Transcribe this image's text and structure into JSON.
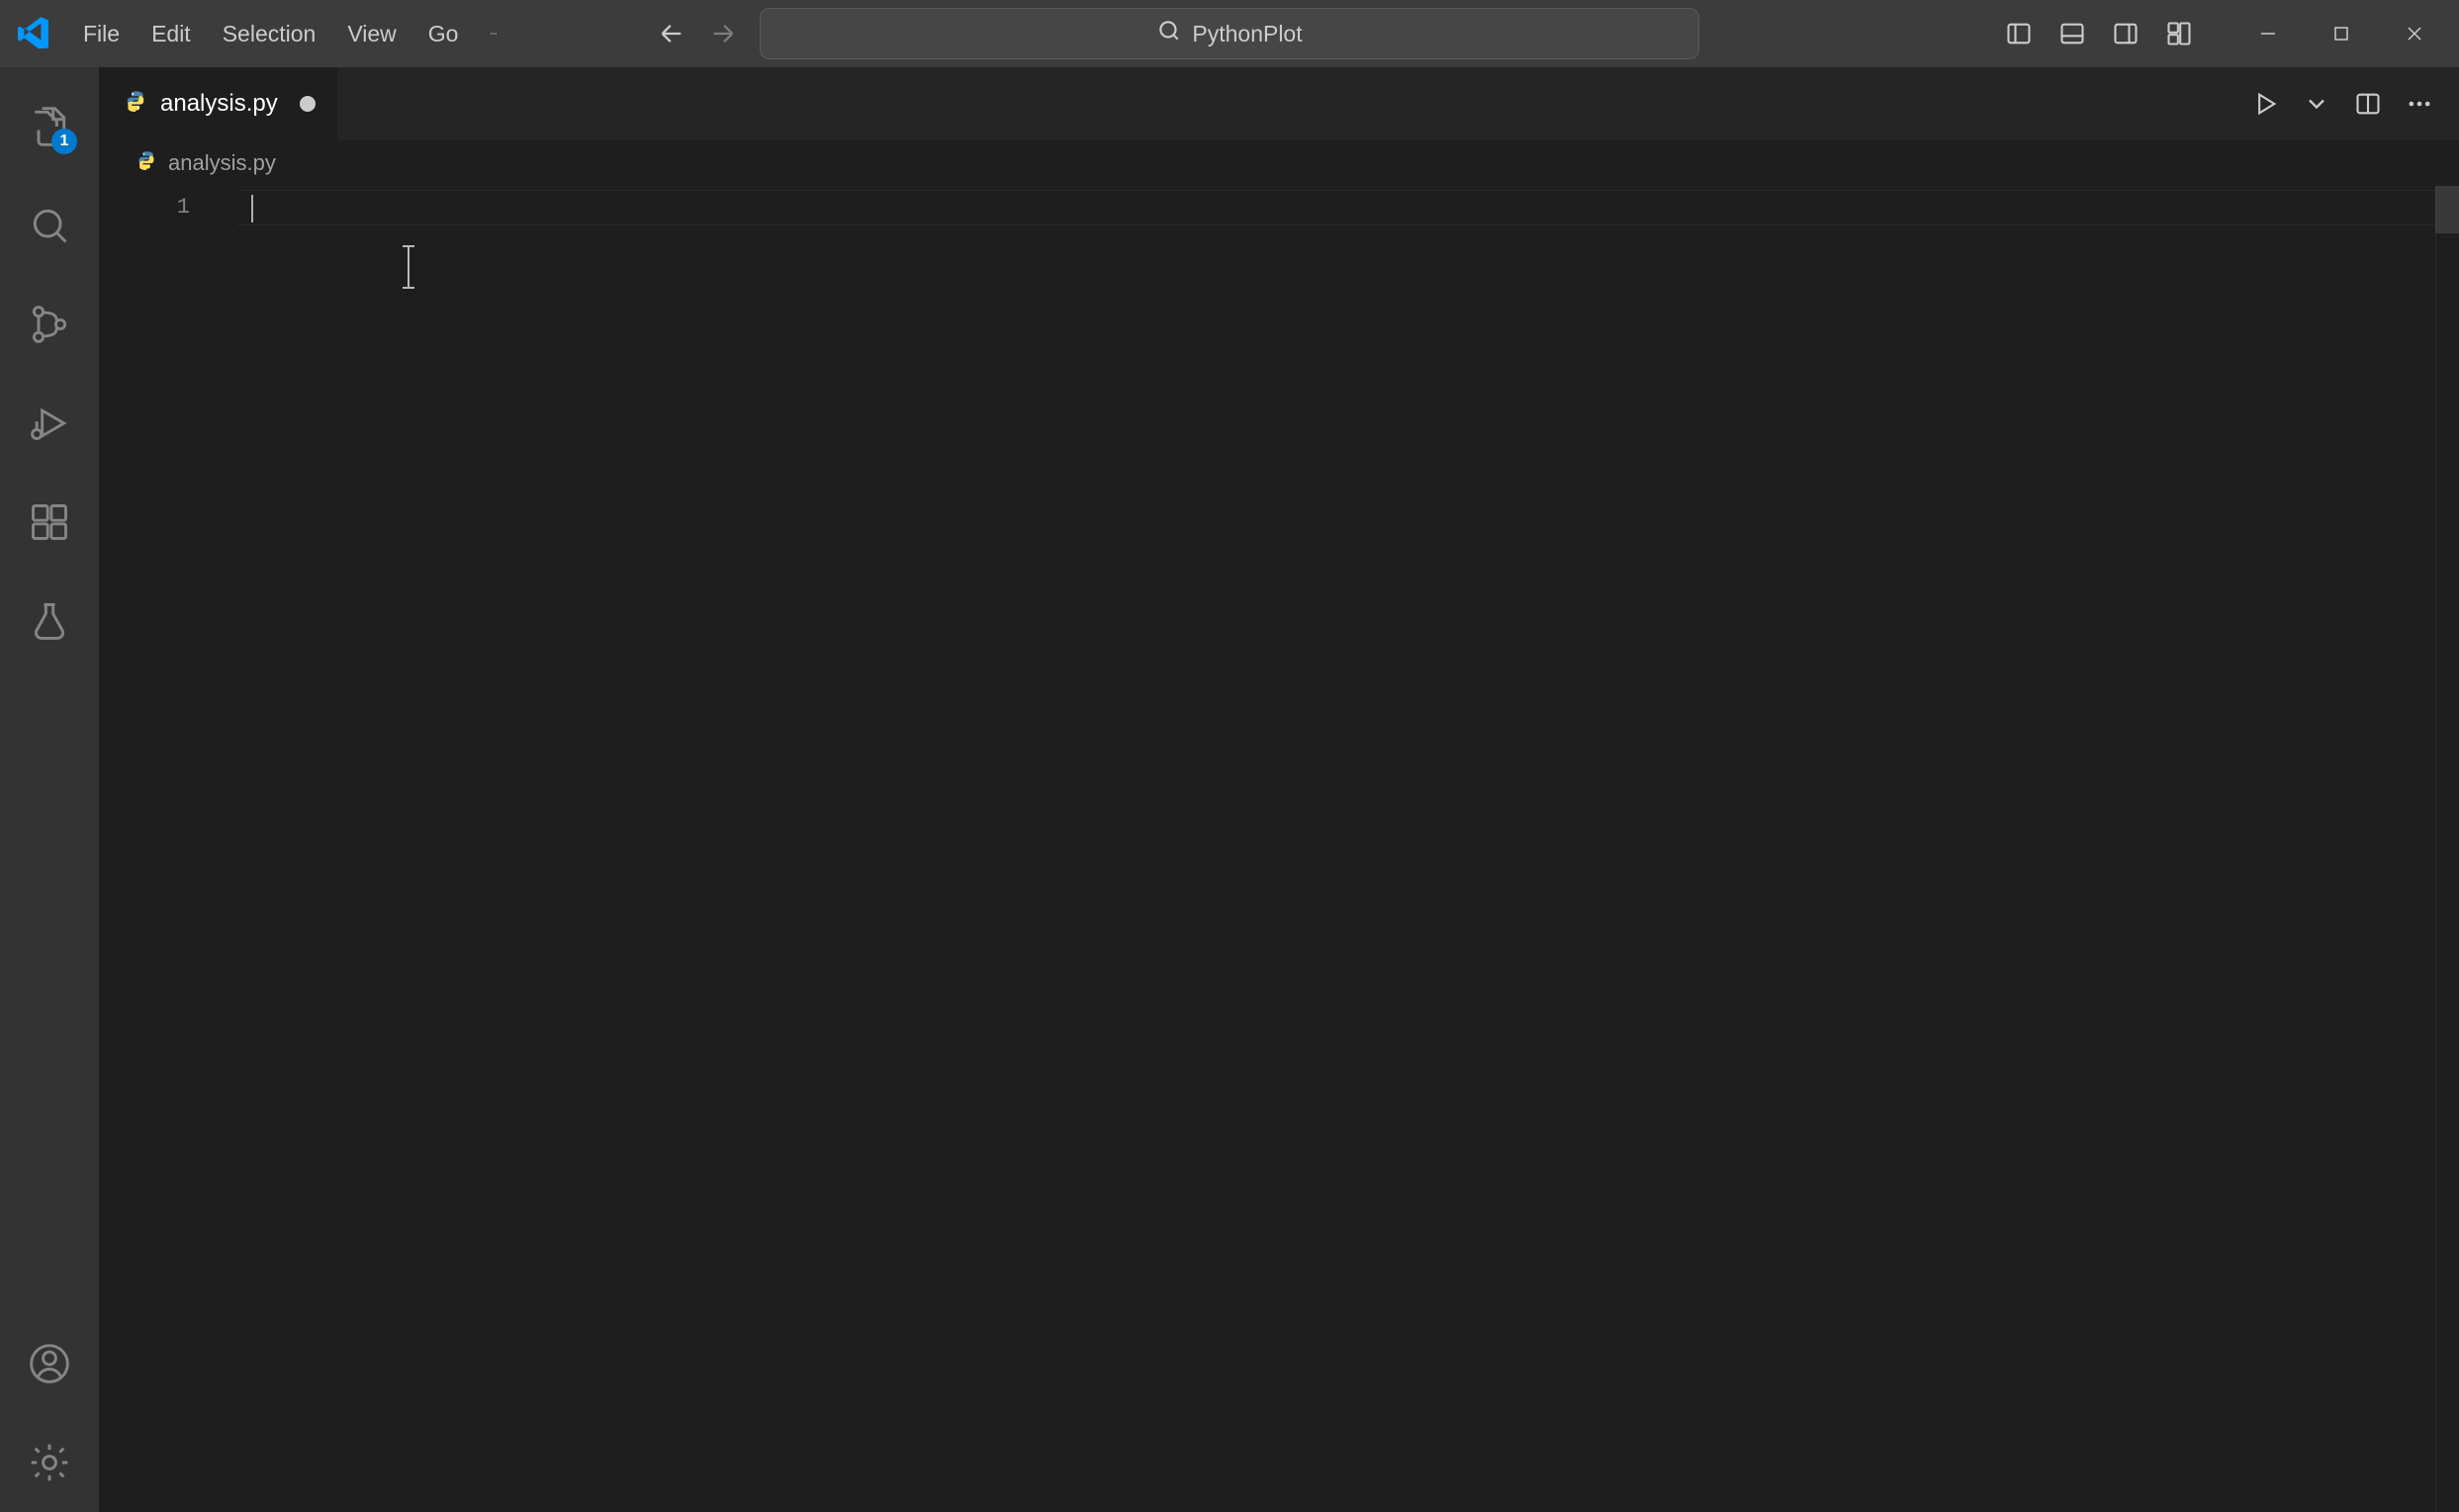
{
  "menu": {
    "items": [
      "File",
      "Edit",
      "Selection",
      "View",
      "Go"
    ]
  },
  "search": {
    "text": "PythonPlot"
  },
  "activity": {
    "explorer_badge": "1"
  },
  "tab": {
    "filename": "analysis.py"
  },
  "breadcrumb": {
    "filename": "analysis.py"
  },
  "editor": {
    "line_numbers": [
      "1"
    ],
    "content": ""
  }
}
